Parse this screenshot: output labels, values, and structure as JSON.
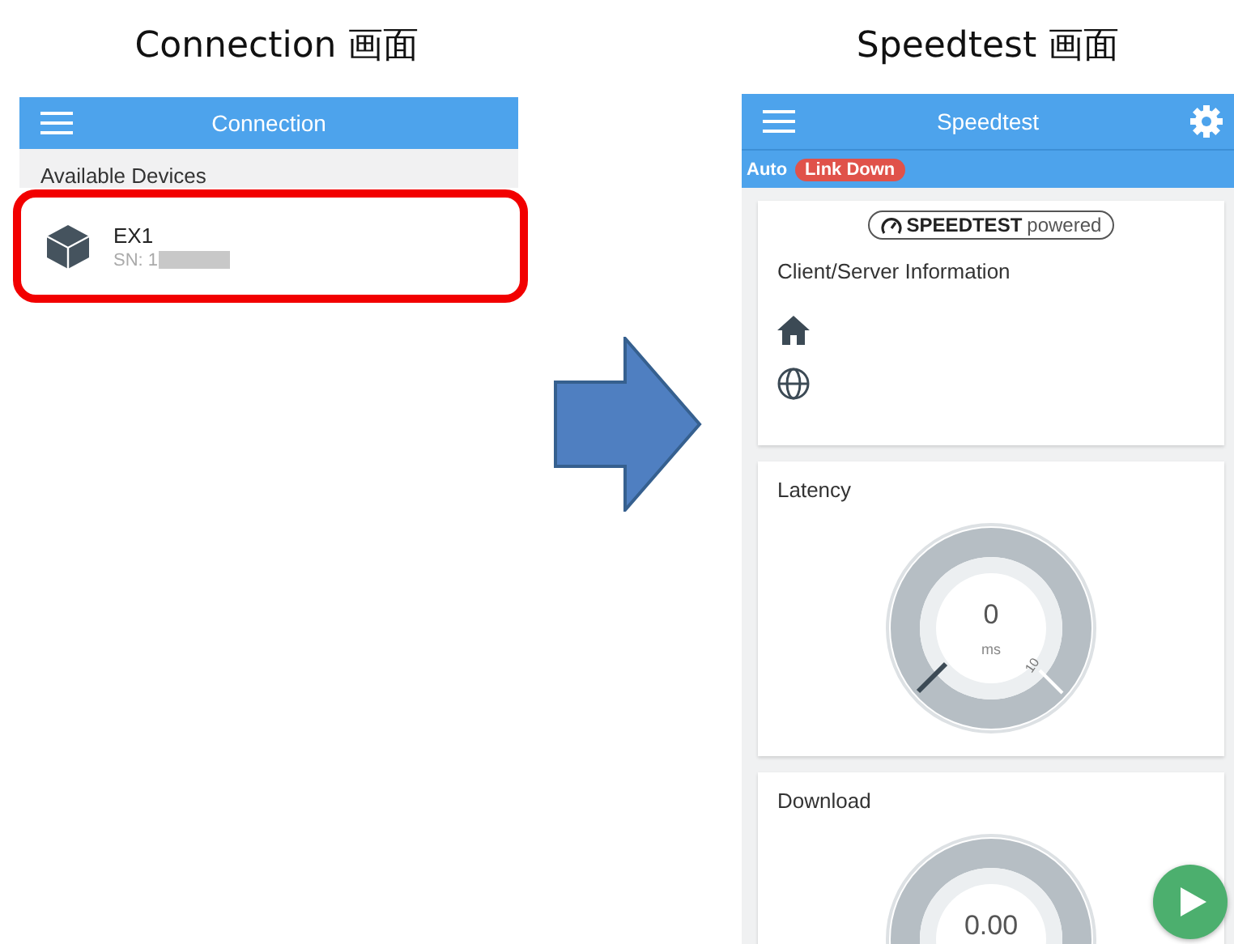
{
  "connection": {
    "caption": "Connection 画面",
    "title": "Connection",
    "section": "Available Devices",
    "devices": [
      {
        "name": "EX1",
        "serial": "SN: 1",
        "highlighted": true
      }
    ]
  },
  "speedtest": {
    "caption": "Speedtest 画面",
    "title": "Speedtest",
    "mode": "Auto",
    "link_status": "Link Down",
    "logo": {
      "brand": "SPEEDTEST",
      "suffix": "powered"
    },
    "info_title": "Client/Server Information",
    "gauges": [
      {
        "title": "Latency",
        "value": "0",
        "unit": "ms",
        "tick": "10"
      },
      {
        "title": "Download",
        "value": "0.00"
      }
    ]
  }
}
